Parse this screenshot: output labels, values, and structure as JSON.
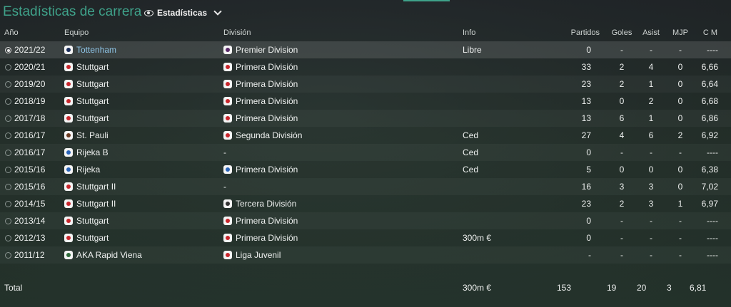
{
  "header": {
    "title": "Estadísticas de carrera",
    "view_label": "Estadísticas"
  },
  "columns": {
    "year": "Año",
    "team": "Equipo",
    "division": "División",
    "info": "Info",
    "apps": "Partidos",
    "goals": "Goles",
    "assists": "Asist",
    "mjp": "MJP",
    "avg": "C M"
  },
  "rows": [
    {
      "year": "2021/22",
      "team": "Tottenham",
      "team_icon": "tottenham-crest-icon",
      "division": "Premier Division",
      "division_icon": "premier-league-icon",
      "info": "Libre",
      "apps": "0",
      "goals": "-",
      "assists": "-",
      "mjp": "-",
      "avg": "----",
      "selected": true
    },
    {
      "year": "2020/21",
      "team": "Stuttgart",
      "team_icon": "stuttgart-crest-icon",
      "division": "Primera División",
      "division_icon": "bundesliga-icon",
      "info": "",
      "apps": "33",
      "goals": "2",
      "assists": "4",
      "mjp": "0",
      "avg": "6,66"
    },
    {
      "year": "2019/20",
      "team": "Stuttgart",
      "team_icon": "stuttgart-crest-icon",
      "division": "Primera División",
      "division_icon": "bundesliga-icon",
      "info": "",
      "apps": "23",
      "goals": "2",
      "assists": "1",
      "mjp": "0",
      "avg": "6,64"
    },
    {
      "year": "2018/19",
      "team": "Stuttgart",
      "team_icon": "stuttgart-crest-icon",
      "division": "Primera División",
      "division_icon": "bundesliga-icon",
      "info": "",
      "apps": "13",
      "goals": "0",
      "assists": "2",
      "mjp": "0",
      "avg": "6,68"
    },
    {
      "year": "2017/18",
      "team": "Stuttgart",
      "team_icon": "stuttgart-crest-icon",
      "division": "Primera División",
      "division_icon": "bundesliga-icon",
      "info": "",
      "apps": "13",
      "goals": "6",
      "assists": "1",
      "mjp": "0",
      "avg": "6,86"
    },
    {
      "year": "2016/17",
      "team": "St. Pauli",
      "team_icon": "st-pauli-crest-icon",
      "division": "Segunda División",
      "division_icon": "2-bundesliga-icon",
      "info": "Ced",
      "apps": "27",
      "goals": "4",
      "assists": "6",
      "mjp": "2",
      "avg": "6,92"
    },
    {
      "year": "2016/17",
      "team": "Rijeka B",
      "team_icon": "rijeka-crest-icon",
      "division": "-",
      "division_icon": "",
      "info": "Ced",
      "apps": "0",
      "goals": "-",
      "assists": "-",
      "mjp": "-",
      "avg": "----"
    },
    {
      "year": "2015/16",
      "team": "Rijeka",
      "team_icon": "rijeka-crest-icon",
      "division": "Primera División",
      "division_icon": "hnl-icon",
      "info": "Ced",
      "apps": "5",
      "goals": "0",
      "assists": "0",
      "mjp": "0",
      "avg": "6,38"
    },
    {
      "year": "2015/16",
      "team": "Stuttgart II",
      "team_icon": "stuttgart-crest-icon",
      "division": "-",
      "division_icon": "",
      "info": "",
      "apps": "16",
      "goals": "3",
      "assists": "3",
      "mjp": "0",
      "avg": "7,02"
    },
    {
      "year": "2014/15",
      "team": "Stuttgart II",
      "team_icon": "stuttgart-crest-icon",
      "division": "Tercera División",
      "division_icon": "3-liga-icon",
      "info": "",
      "apps": "23",
      "goals": "2",
      "assists": "3",
      "mjp": "1",
      "avg": "6,97"
    },
    {
      "year": "2013/14",
      "team": "Stuttgart",
      "team_icon": "stuttgart-crest-icon",
      "division": "Primera División",
      "division_icon": "bundesliga-icon",
      "info": "",
      "apps": "0",
      "goals": "-",
      "assists": "-",
      "mjp": "-",
      "avg": "----"
    },
    {
      "year": "2012/13",
      "team": "Stuttgart",
      "team_icon": "stuttgart-crest-icon",
      "division": "Primera División",
      "division_icon": "bundesliga-icon",
      "info": "300m €",
      "apps": "0",
      "goals": "-",
      "assists": "-",
      "mjp": "-",
      "avg": "----"
    },
    {
      "year": "2011/12",
      "team": "AKA Rapid Viena",
      "team_icon": "rapid-crest-icon",
      "division": "Liga Juvenil",
      "division_icon": "youth-league-icon",
      "info": "",
      "apps": "-",
      "goals": "-",
      "assists": "-",
      "mjp": "-",
      "avg": "----"
    }
  ],
  "total": {
    "label": "Total",
    "info": "300m €",
    "apps": "153",
    "goals": "19",
    "assists": "20",
    "mjp": "3",
    "avg": "6,81"
  },
  "colors": {
    "accent": "#3fa28a",
    "link": "#8fc6e8"
  }
}
